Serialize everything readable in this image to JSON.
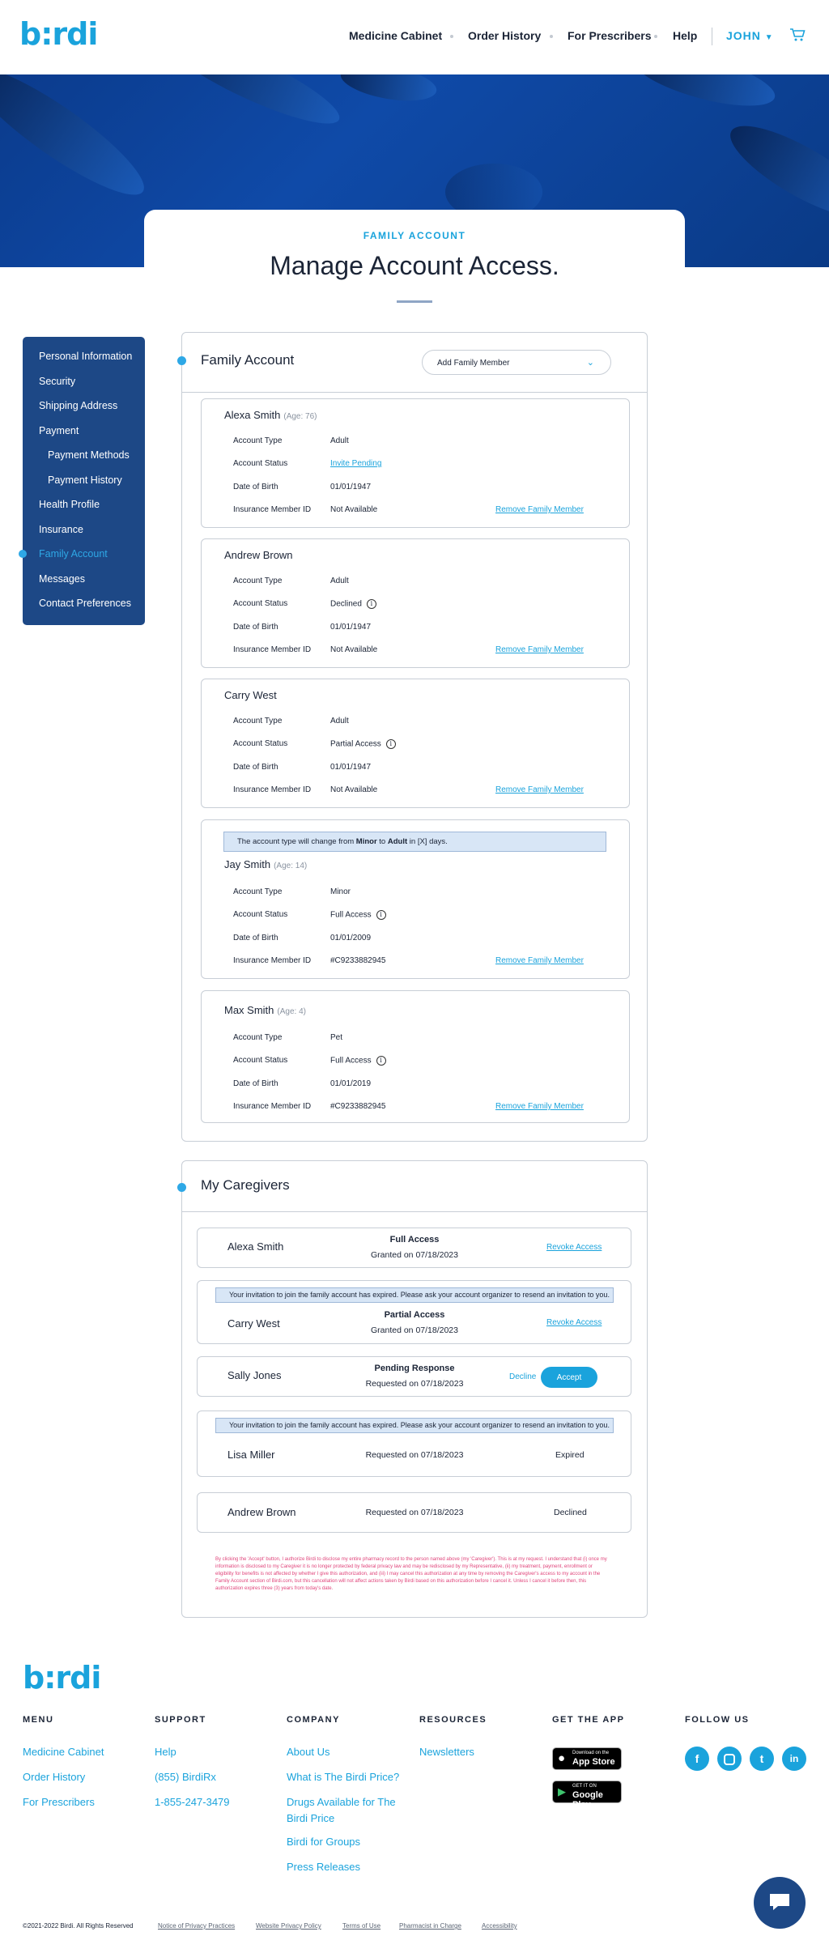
{
  "header": {
    "logo": "b:rdi",
    "nav": [
      "Medicine Cabinet",
      "Order History",
      "For Prescribers",
      "Help"
    ],
    "user": "JOHN"
  },
  "title_card": {
    "eyebrow": "FAMILY ACCOUNT",
    "title": "Manage Account Access."
  },
  "sidebar": {
    "items": [
      {
        "label": "Personal Information"
      },
      {
        "label": "Security"
      },
      {
        "label": "Shipping Address"
      },
      {
        "label": "Payment"
      },
      {
        "label": "Payment Methods"
      },
      {
        "label": "Payment History"
      },
      {
        "label": "Health Profile"
      },
      {
        "label": "Insurance"
      },
      {
        "label": "Family Account"
      },
      {
        "label": "Messages"
      },
      {
        "label": "Contact Preferences"
      }
    ]
  },
  "family": {
    "title": "Family Account",
    "add_member": "Add Family Member",
    "labels": {
      "type": "Account Type",
      "status": "Account Status",
      "dob": "Date of Birth",
      "ins": "Insurance Member ID"
    },
    "remove_label": "Remove Family Member",
    "members": [
      {
        "name": "Alexa Smith",
        "age": "(Age: 76)",
        "type": "Adult",
        "status": "Invite Pending",
        "dob": "01/01/1947",
        "ins": "Not Available"
      },
      {
        "name": "Andrew Brown",
        "age": "",
        "type": "Adult",
        "status": "Declined",
        "dob": "01/01/1947",
        "ins": "Not Available"
      },
      {
        "name": "Carry West",
        "age": "",
        "type": "Adult",
        "status": "Partial Access",
        "dob": "01/01/1947",
        "ins": "Not Available"
      },
      {
        "name": "Jay Smith",
        "age": "(Age: 14)",
        "type": "Minor",
        "status": "Full Access",
        "dob": "01/01/2009",
        "ins": "#C9233882945",
        "notice_a": "The account type will change from ",
        "notice_from": "Minor",
        "notice_b": " to ",
        "notice_to": "Adult",
        "notice_c": " in [X] days."
      },
      {
        "name": "Max Smith",
        "age": "(Age: 4)",
        "type": "Pet",
        "status": "Full Access",
        "dob": "01/01/2019",
        "ins": "#C9233882945"
      }
    ]
  },
  "caregivers": {
    "title": "My Caregivers",
    "expired_notice": "Your invitation to join the family account has expired. Please ask your account organizer to resend an invitation to you.",
    "items": [
      {
        "name": "Alexa Smith",
        "status": "Full Access",
        "date": "Granted on 07/18/2023",
        "action": "Revoke Access"
      },
      {
        "name": "Carry West",
        "status": "Partial Access",
        "date": "Granted on 07/18/2023",
        "action": "Revoke Access"
      },
      {
        "name": "Sally Jones",
        "status": "Pending Response",
        "date": "Requested on 07/18/2023",
        "decline": "Decline",
        "accept": "Accept"
      },
      {
        "name": "Lisa Miller",
        "date": "Requested on 07/18/2023",
        "result": "Expired"
      },
      {
        "name": "Andrew Brown",
        "date": "Requested on 07/18/2023",
        "result": "Declined"
      }
    ],
    "disclaimer": "By clicking the 'Accept' button, I authorize Birdi to disclose my entire pharmacy record to the person named above (my 'Caregiver'). This is at my request. I understand that (i) once my information is disclosed to my Caregiver it is no longer protected by federal privacy law and may be redisclosed by my Representative, (ii) my treatment, payment, enrollment or eligibility for benefits is not affected by whether I give this authorization, and (iii) I may cancel this authorization at any time by removing the Caregiver's access to my account in the Family Account section of Birdi.com, but this cancellation will not affect actions taken by Birdi based on this authorization before I cancel it. Unless I cancel it before then, this authorization expires three (3) years from today's date."
  },
  "footer": {
    "logo": "b:rdi",
    "menu": {
      "title": "MENU",
      "links": [
        "Medicine Cabinet",
        "Order History",
        "For Prescribers"
      ]
    },
    "support": {
      "title": "SUPPORT",
      "links": [
        "Help",
        "(855) BirdiRx",
        "1-855-247-3479"
      ]
    },
    "company": {
      "title": "COMPANY",
      "links": [
        "About Us",
        "What is The Birdi Price?",
        "Drugs Available for The",
        "Birdi Price",
        "Birdi for Groups",
        "Press Releases"
      ]
    },
    "resources": {
      "title": "RESOURCES",
      "links": [
        "Newsletters"
      ]
    },
    "app": {
      "title": "GET THE APP",
      "appstore_small": "Download on the",
      "appstore": "App Store",
      "gplay_small": "GET IT ON",
      "gplay": "Google Play"
    },
    "follow": {
      "title": "FOLLOW US",
      "icons": [
        "facebook-icon",
        "instagram-icon",
        "twitter-icon",
        "linkedin-icon"
      ]
    },
    "copyright": "©2021-2022 Birdi. All Rights Reserved",
    "legal": [
      "Notice of Privacy Practices",
      "Website Privacy Policy",
      "Terms of Use",
      "Pharmacist in Charge",
      "Accessibility"
    ]
  },
  "colors": {
    "brand": "#1aa3dc",
    "sidebar": "#1d4886",
    "hero": "#0f4aa8",
    "notice": "#d8e6f6",
    "disclaimer": "#e0457b"
  }
}
